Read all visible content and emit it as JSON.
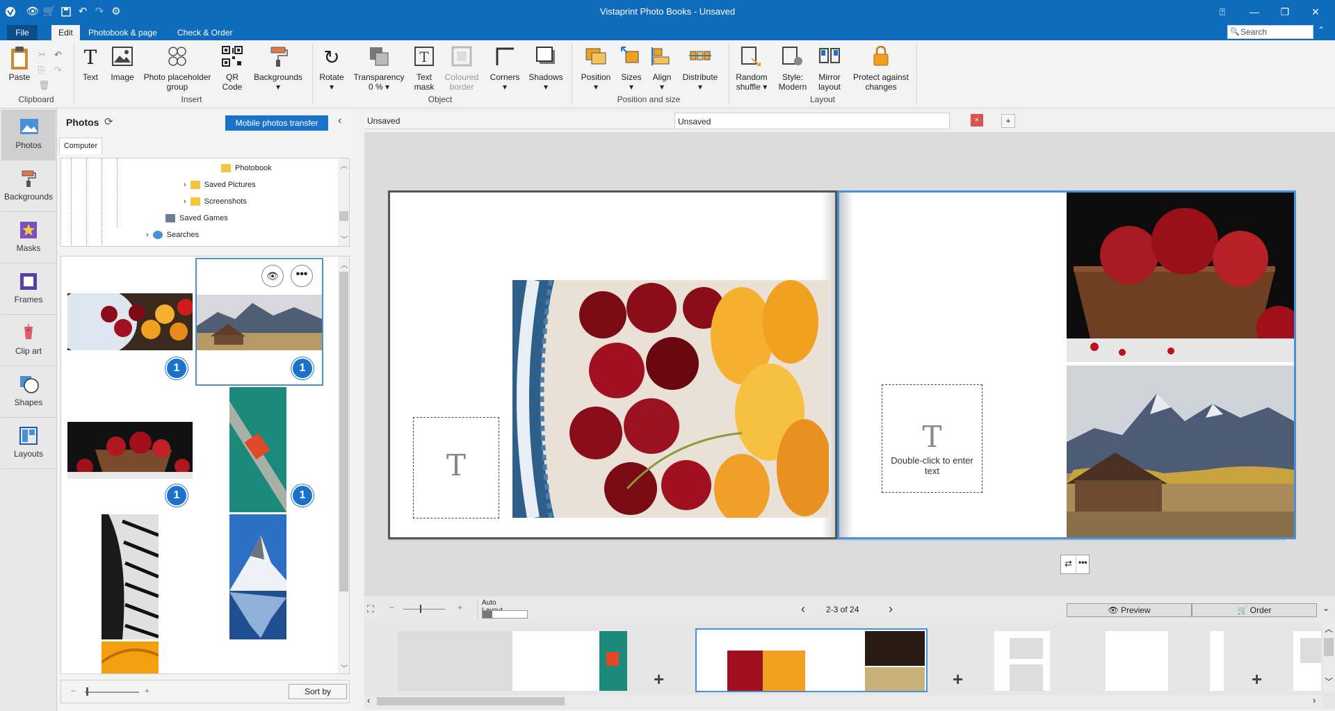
{
  "app": {
    "title": "Vistaprint Photo Books - Unsaved"
  },
  "menu": {
    "file": "File",
    "edit": "Edit",
    "photobook": "Photobook & page",
    "check": "Check & Order"
  },
  "search": {
    "placeholder": "Search"
  },
  "ribbon": {
    "paste": "Paste",
    "clipboard": "Clipboard",
    "text": "Text",
    "image": "Image",
    "photo_placeholder": "Photo placeholder",
    "group": "group",
    "qr": "QR",
    "code": "Code",
    "backgrounds": "Backgrounds",
    "insert": "Insert",
    "rotate": "Rotate",
    "transparency": "Transparency",
    "transparency_value": "0 %",
    "text_label": "Text",
    "mask": "mask",
    "coloured": "Coloured",
    "border": "border",
    "corners": "Corners",
    "shadows": "Shadows",
    "object": "Object",
    "position": "Position",
    "sizes": "Sizes",
    "align": "Align",
    "distribute": "Distribute",
    "position_and_size": "Position and size",
    "random": "Random",
    "shuffle": "shuffle",
    "style": "Style:",
    "modern": "Modern",
    "mirror": "Mirror",
    "layout_word": "layout",
    "protect": "Protect against",
    "changes": "changes",
    "layout": "Layout"
  },
  "lefttabs": [
    "Photos",
    "Backgrounds",
    "Masks",
    "Frames",
    "Clip art",
    "Shapes",
    "Layouts"
  ],
  "photos": {
    "title": "Photos",
    "mobile_transfer": "Mobile photos transfer",
    "tab_computer": "Computer",
    "tree": [
      "Photobook",
      "Saved Pictures",
      "Screenshots",
      "Saved Games",
      "Searches"
    ],
    "badges": [
      "1",
      "1",
      "1",
      "1"
    ],
    "sort_by": "Sort by"
  },
  "doc_tabs": [
    "Unsaved",
    "Unsaved"
  ],
  "canvas": {
    "textbox_hint": "Double-click to enter text",
    "t_glyph": "T"
  },
  "nav": {
    "auto_layout": "Auto Layout",
    "page_range": "2-3 of 24",
    "preview": "Preview",
    "order": "Order"
  },
  "colors": {
    "accent": "#0f6cbd",
    "badge": "#1a73c8",
    "selection": "#4a90d9"
  }
}
